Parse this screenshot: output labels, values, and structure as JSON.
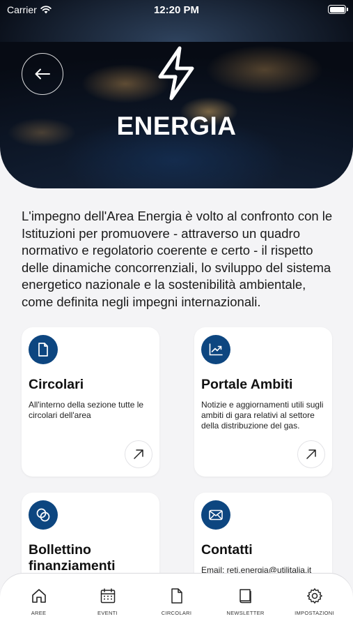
{
  "status_bar": {
    "carrier": "Carrier",
    "time": "12:20 PM"
  },
  "hero": {
    "title": "ENERGIA"
  },
  "description": "L'impegno dell'Area Energia è volto al confronto con le Istituzioni per promuovere - attraverso un quadro normativo e regolatorio coerente e certo - il rispetto delle dinamiche concorrenziali, lo sviluppo del sistema energetico nazionale e la sostenibilità ambientale, come definita negli impegni internazionali.",
  "cards": [
    {
      "title": "Circolari",
      "text": "All'interno della sezione tutte le circolari dell'area",
      "icon": "document-icon"
    },
    {
      "title": "Portale Ambiti",
      "text": "Notizie e aggiornamenti utili sugli ambiti di gara relativi al settore della distribuzione del gas.",
      "icon": "chart-icon"
    },
    {
      "title": "Bollettino finanziamenti",
      "text": "",
      "icon": "coins-icon"
    },
    {
      "title": "Contatti",
      "text": "Email: reti.energia@utilitalia.it",
      "icon": "mail-icon"
    }
  ],
  "tabs": [
    {
      "label": "AREE",
      "icon": "home-icon"
    },
    {
      "label": "EVENTI",
      "icon": "calendar-icon"
    },
    {
      "label": "CIRCOLARI",
      "icon": "document-icon"
    },
    {
      "label": "NEWSLETTER",
      "icon": "book-icon"
    },
    {
      "label": "IMPOSTAZIONI",
      "icon": "gear-icon"
    }
  ],
  "colors": {
    "accent": "#0d4680",
    "background": "#f4f4f6",
    "card": "#ffffff"
  }
}
